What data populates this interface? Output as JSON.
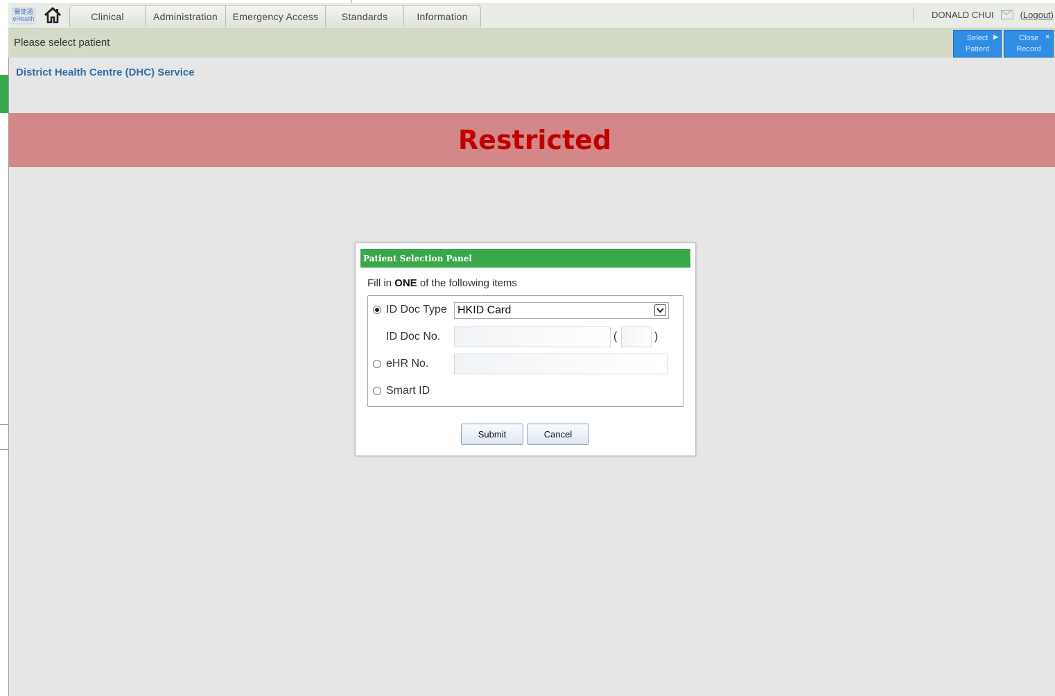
{
  "nav": {
    "logo_text": "醫健通 eHealth",
    "tabs": [
      "Clinical",
      "Administration",
      "Emergency Access",
      "Standards",
      "Information"
    ],
    "user_name": "DONALD CHUI",
    "logout_label": "(Logout)"
  },
  "status": {
    "message": "Please select patient",
    "select_patient_label": [
      "Select",
      "Patient"
    ],
    "close_record_label": [
      "Close",
      "Record"
    ]
  },
  "service_title": "District Health Centre (DHC) Service",
  "banner": {
    "text": "Restricted",
    "color": "#c00000",
    "background": "#d48787"
  },
  "panel": {
    "title": "Patient Selection Panel",
    "instruction_prefix": "Fill in ",
    "instruction_emphasis": "ONE",
    "instruction_suffix": " of the following items",
    "id_doc_type_label": "ID Doc Type",
    "id_doc_type_value": "HKID Card",
    "id_doc_no_label": "ID Doc No.",
    "id_doc_no_value": "",
    "check_digit_value": "",
    "ehr_no_label": "eHR No.",
    "ehr_no_value": "",
    "smart_id_label": "Smart ID",
    "selected_option": "ID Doc Type",
    "submit_label": "Submit",
    "cancel_label": "Cancel",
    "header_color": "#39a84a"
  }
}
